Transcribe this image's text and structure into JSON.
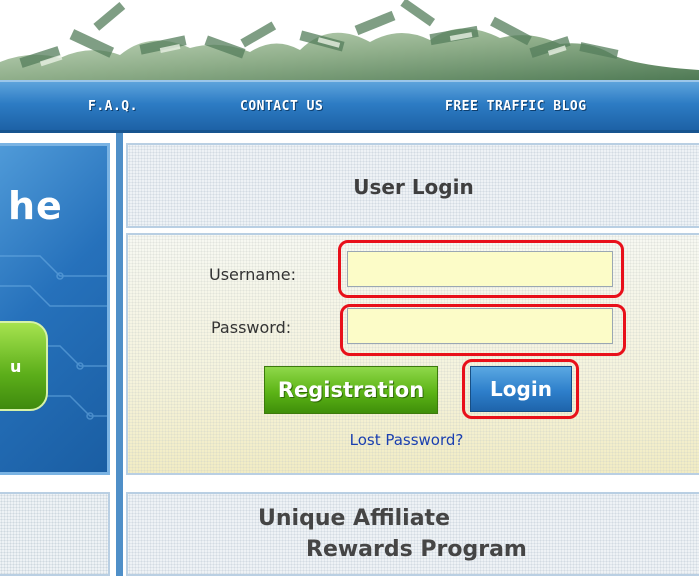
{
  "header": {
    "banner_image": "money-pile-banner"
  },
  "nav": {
    "items": [
      {
        "label": "F.A.Q."
      },
      {
        "label": "CONTACT US"
      },
      {
        "label": "FREE TRAFFIC BLOG"
      }
    ]
  },
  "promo": {
    "text": "he",
    "button_label": "u"
  },
  "login": {
    "title": "User Login",
    "username_label": "Username:",
    "username_value": "",
    "password_label": "Password:",
    "password_value": "",
    "register_label": "Registration",
    "login_label": "Login",
    "lost_password_label": "Lost Password?",
    "highlight_color": "#e8101a"
  },
  "affiliate": {
    "line1": "Unique Affiliate",
    "line2": "Rewards Program"
  },
  "colors": {
    "nav_blue": "#2d7cc4",
    "register_green": "#5cb416",
    "login_blue": "#2e7fcb",
    "link_blue": "#1a3fb0",
    "input_yellow": "#fcfcc8"
  }
}
